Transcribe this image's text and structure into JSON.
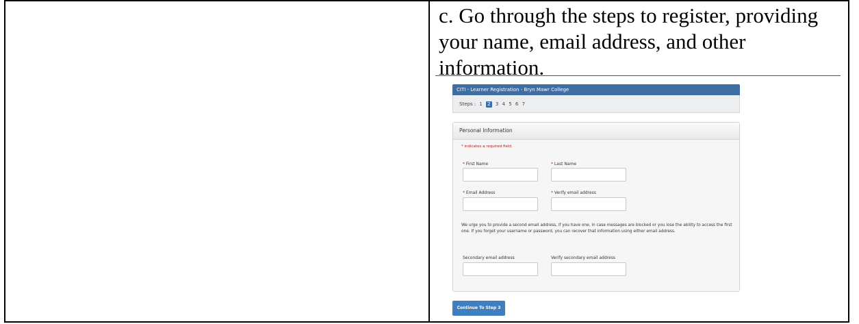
{
  "instruction": "c. Go through the steps to register, providing your name, email address, and other information.",
  "screenshot": {
    "title": "CITI - Learner Registration - Bryn Mawr College",
    "steps_label": "Steps :",
    "steps": [
      "1",
      "2",
      "3",
      "4",
      "5",
      "6",
      "7"
    ],
    "current_step": "2",
    "panel_title": "Personal Information",
    "required_note": "* indicates a required field.",
    "required_star": "*",
    "fields": {
      "first_name": "First Name",
      "last_name": "Last Name",
      "email": "Email Address",
      "verify_email": "Verify email address",
      "secondary_email": "Secondary email address",
      "verify_secondary_email": "Verify secondary email address"
    },
    "secondary_note": "We urge you to provide a second email address, if you have one, in case messages are blocked or you lose the ability to access the first one. If you forget your username or password, you can recover that information using either email address.",
    "continue_label": "Continue To Step 3"
  }
}
